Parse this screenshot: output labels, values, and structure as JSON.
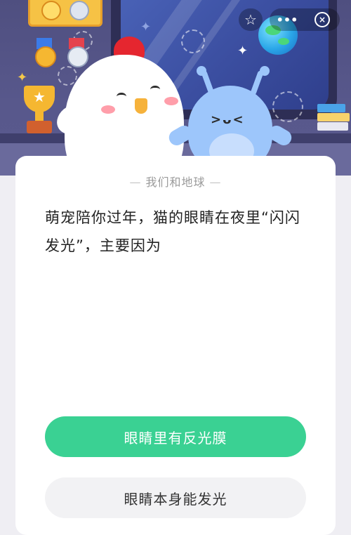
{
  "top_controls": {
    "star_icon": "☆",
    "more_icon": "•••",
    "close_icon": "×"
  },
  "card": {
    "header": "我们和地球",
    "header_dash_left": "—",
    "header_dash_right": "—",
    "question": "萌宠陪你过年，猫的眼睛在夜里“闪闪发光”，主要因为"
  },
  "answers": [
    {
      "label": "眼睛里有反光膜"
    },
    {
      "label": "眼睛本身能发光"
    }
  ],
  "colors": {
    "primary_answer": "#3ad193",
    "secondary_answer": "#f2f2f4",
    "banner_bg": "#4f4f80"
  }
}
